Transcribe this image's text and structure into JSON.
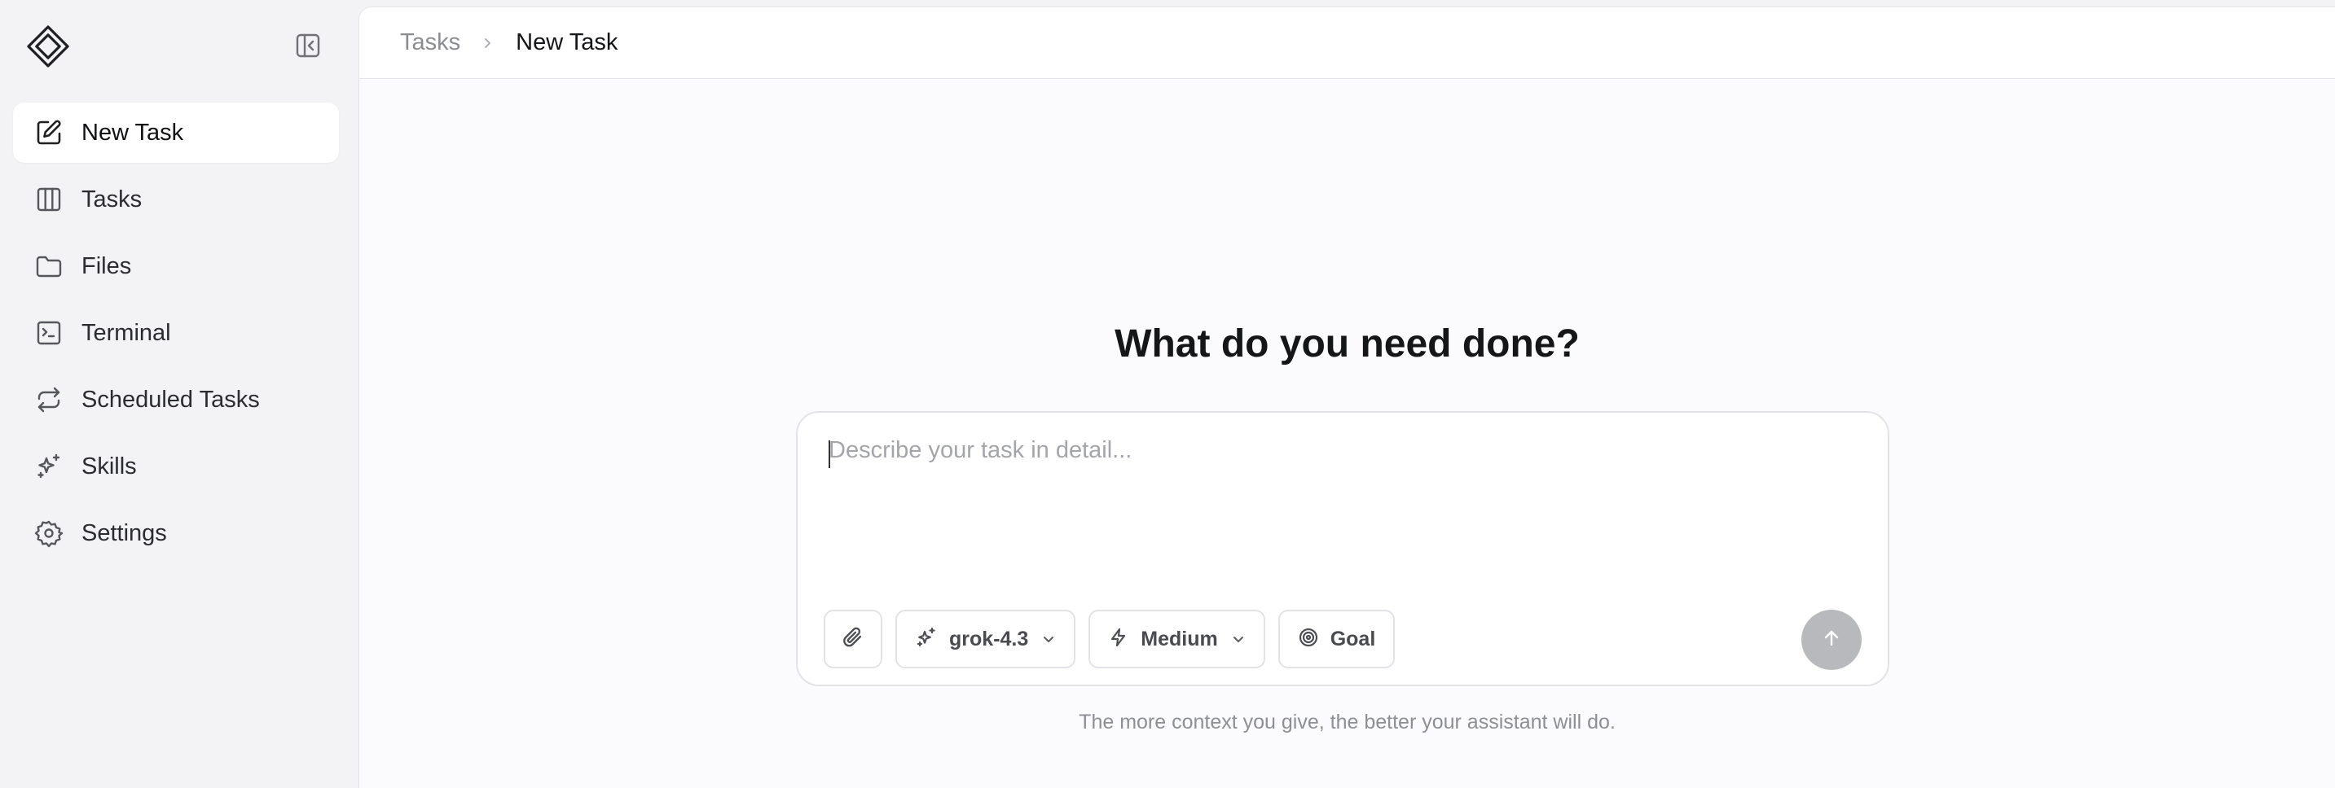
{
  "sidebar": {
    "items": [
      {
        "label": "New Task",
        "icon": "edit-icon",
        "active": true
      },
      {
        "label": "Tasks",
        "icon": "columns-icon"
      },
      {
        "label": "Files",
        "icon": "folder-icon"
      },
      {
        "label": "Terminal",
        "icon": "terminal-icon"
      },
      {
        "label": "Scheduled Tasks",
        "icon": "repeat-icon"
      },
      {
        "label": "Skills",
        "icon": "sparkles-icon"
      },
      {
        "label": "Settings",
        "icon": "gear-icon"
      }
    ]
  },
  "breadcrumb": {
    "root": "Tasks",
    "current": "New Task"
  },
  "main": {
    "heading": "What do you need done?",
    "input_placeholder": "Describe your task in detail...",
    "model_label": "grok-4.3",
    "effort_label": "Medium",
    "goal_label": "Goal",
    "hint": "The more context you give, the better your assistant will do."
  },
  "colors": {
    "sidebar_bg": "#f3f3f5",
    "main_bg": "#fbfbfd",
    "send_button": "#b8b9bd"
  }
}
